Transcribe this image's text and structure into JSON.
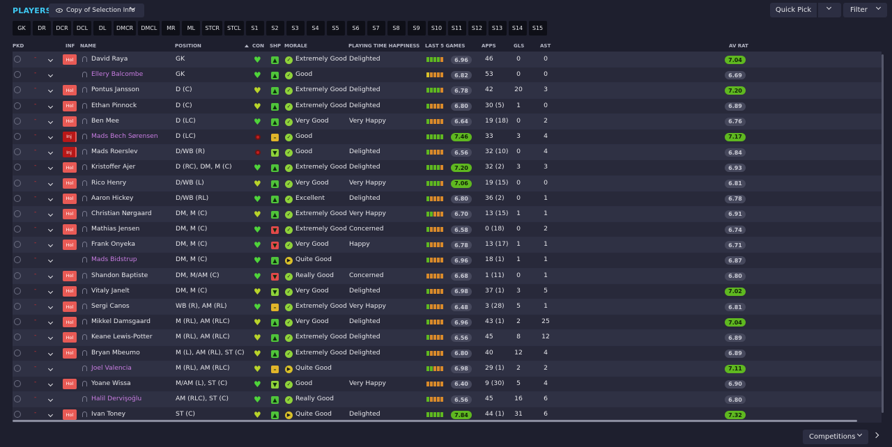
{
  "header": {
    "title": "PLAYERS",
    "selection_label": "Copy of Selection Info",
    "quick_pick": "Quick Pick",
    "filter": "Filter"
  },
  "positions": [
    "GK",
    "DR",
    "DCR",
    "DCL",
    "DL",
    "DMCR",
    "DMCL",
    "MR",
    "ML",
    "STCR",
    "STCL",
    "S1",
    "S2",
    "S3",
    "S4",
    "S5",
    "S6",
    "S7",
    "S8",
    "S9",
    "S10",
    "S11",
    "S12",
    "S13",
    "S14",
    "S15"
  ],
  "columns": {
    "pkd": "PKD",
    "inf": "INF",
    "name": "NAME",
    "position": "POSITION",
    "con": "CON",
    "shp": "SHP",
    "morale": "MORALE",
    "pth": "PLAYING TIME HAPPINESS",
    "last5": "LAST 5 GAMES",
    "apps": "APPS",
    "gls": "GLS",
    "ast": "AST",
    "avrat": "AV RAT"
  },
  "colors": {
    "accent": "#3ec7f0",
    "hol": "#e85a55",
    "inj": "#b81818",
    "loan_name": "#c77ce0",
    "green": "#5fb820",
    "orange": "#d98a2a",
    "yellow": "#d9c02a",
    "red": "#d84040"
  },
  "players": [
    {
      "name": "David Raya",
      "inf": "Hol",
      "loan": false,
      "position": "GK",
      "con": "heart-green",
      "shp": "up",
      "morale_icon": "tick",
      "morale": "Extremely Good",
      "pth": "Delighted",
      "form": [
        "g",
        "g",
        "g",
        "g",
        "o"
      ],
      "last5": "6.96",
      "last5_hi": false,
      "apps": "46",
      "gls": "0",
      "ast": "0",
      "avrat": "7.04",
      "avrat_hi": true
    },
    {
      "name": "Ellery Balcombe",
      "inf": "",
      "loan": true,
      "position": "GK",
      "con": "heart-green",
      "shp": "up",
      "morale_icon": "tick",
      "morale": "Good",
      "pth": "",
      "form": [
        "y",
        "o",
        "o",
        "o",
        "o"
      ],
      "last5": "6.82",
      "last5_hi": false,
      "apps": "53",
      "gls": "0",
      "ast": "0",
      "avrat": "6.69",
      "avrat_hi": false
    },
    {
      "name": "Pontus Jansson",
      "inf": "Hol",
      "loan": false,
      "position": "D (C)",
      "con": "heart-yellow",
      "shp": "up",
      "morale_icon": "tick",
      "morale": "Extremely Good",
      "pth": "Delighted",
      "form": [
        "g",
        "g",
        "g",
        "g",
        "o"
      ],
      "last5": "6.78",
      "last5_hi": false,
      "apps": "42",
      "gls": "20",
      "ast": "3",
      "avrat": "7.20",
      "avrat_hi": true
    },
    {
      "name": "Ethan Pinnock",
      "inf": "Hol",
      "loan": false,
      "position": "D (C)",
      "con": "heart-yellow",
      "shp": "up",
      "morale_icon": "tick",
      "morale": "Extremely Good",
      "pth": "Delighted",
      "form": [
        "g",
        "o",
        "o",
        "o",
        "o"
      ],
      "last5": "6.80",
      "last5_hi": false,
      "apps": "30 (5)",
      "gls": "1",
      "ast": "0",
      "avrat": "6.89",
      "avrat_hi": false
    },
    {
      "name": "Ben Mee",
      "inf": "Hol",
      "loan": false,
      "position": "D (LC)",
      "con": "heart-green",
      "shp": "up",
      "morale_icon": "tick",
      "morale": "Very Good",
      "pth": "Very Happy",
      "form": [
        "g",
        "o",
        "o",
        "o",
        "o"
      ],
      "last5": "6.64",
      "last5_hi": false,
      "apps": "19 (18)",
      "gls": "0",
      "ast": "2",
      "avrat": "6.76",
      "avrat_hi": false
    },
    {
      "name": "Mads Bech Sørensen",
      "inf": "Inj",
      "loan": true,
      "position": "D (LC)",
      "con": "red",
      "shp": "mid",
      "morale_icon": "tick",
      "morale": "Good",
      "pth": "",
      "form": [
        "g",
        "g",
        "g",
        "g",
        "g"
      ],
      "last5": "7.46",
      "last5_hi": true,
      "apps": "33",
      "gls": "3",
      "ast": "4",
      "avrat": "7.17",
      "avrat_hi": true
    },
    {
      "name": "Mads Roerslev",
      "inf": "Inj",
      "loan": false,
      "position": "D/WB (R)",
      "con": "red",
      "shp": "down",
      "morale_icon": "tick",
      "morale": "Good",
      "pth": "Delighted",
      "form": [
        "g",
        "o",
        "o",
        "o",
        "o"
      ],
      "last5": "6.56",
      "last5_hi": false,
      "apps": "32 (10)",
      "gls": "0",
      "ast": "4",
      "avrat": "6.84",
      "avrat_hi": false
    },
    {
      "name": "Kristoffer Ajer",
      "inf": "Hol",
      "loan": false,
      "position": "D (RC), DM, M (C)",
      "con": "heart-green",
      "shp": "up",
      "morale_icon": "tick",
      "morale": "Extremely Good",
      "pth": "Delighted",
      "form": [
        "g",
        "g",
        "g",
        "g",
        "o"
      ],
      "last5": "7.20",
      "last5_hi": true,
      "apps": "32 (2)",
      "gls": "3",
      "ast": "3",
      "avrat": "6.93",
      "avrat_hi": false
    },
    {
      "name": "Rico Henry",
      "inf": "Hol",
      "loan": false,
      "position": "D/WB (L)",
      "con": "heart-yellow",
      "shp": "up",
      "morale_icon": "tick",
      "morale": "Very Good",
      "pth": "Very Happy",
      "form": [
        "g",
        "g",
        "g",
        "g",
        "o"
      ],
      "last5": "7.06",
      "last5_hi": true,
      "apps": "19 (15)",
      "gls": "0",
      "ast": "0",
      "avrat": "6.81",
      "avrat_hi": false
    },
    {
      "name": "Aaron Hickey",
      "inf": "Hol",
      "loan": false,
      "position": "D/WB (RL)",
      "con": "heart-green",
      "shp": "up",
      "morale_icon": "tick",
      "morale": "Excellent",
      "pth": "Delighted",
      "form": [
        "g",
        "o",
        "o",
        "o",
        "o"
      ],
      "last5": "6.80",
      "last5_hi": false,
      "apps": "36 (2)",
      "gls": "0",
      "ast": "1",
      "avrat": "6.78",
      "avrat_hi": false
    },
    {
      "name": "Christian Nørgaard",
      "inf": "Hol",
      "loan": false,
      "position": "DM, M (C)",
      "con": "heart-yellow",
      "shp": "up",
      "morale_icon": "tick",
      "morale": "Extremely Good",
      "pth": "Very Happy",
      "form": [
        "g",
        "g",
        "o",
        "o",
        "o"
      ],
      "last5": "6.70",
      "last5_hi": false,
      "apps": "13 (15)",
      "gls": "1",
      "ast": "1",
      "avrat": "6.91",
      "avrat_hi": false
    },
    {
      "name": "Mathias Jensen",
      "inf": "Hol",
      "loan": false,
      "position": "DM, M (C)",
      "con": "heart-green",
      "shp": "down-red",
      "morale_icon": "tick",
      "morale": "Extremely Good",
      "pth": "Concerned",
      "form": [
        "g",
        "o",
        "o",
        "o",
        "o"
      ],
      "last5": "6.58",
      "last5_hi": false,
      "apps": "0 (18)",
      "gls": "0",
      "ast": "2",
      "avrat": "6.74",
      "avrat_hi": false
    },
    {
      "name": "Frank Onyeka",
      "inf": "Hol",
      "loan": false,
      "position": "DM, M (C)",
      "con": "heart-green",
      "shp": "down-red",
      "morale_icon": "tick",
      "morale": "Very Good",
      "pth": "Happy",
      "form": [
        "g",
        "o",
        "o",
        "o",
        "o"
      ],
      "last5": "6.78",
      "last5_hi": false,
      "apps": "13 (17)",
      "gls": "1",
      "ast": "1",
      "avrat": "6.71",
      "avrat_hi": false
    },
    {
      "name": "Mads Bidstrup",
      "inf": "",
      "loan": true,
      "position": "DM, M (C)",
      "con": "heart-green",
      "shp": "up",
      "morale_icon": "right",
      "morale": "Quite Good",
      "pth": "",
      "form": [
        "g",
        "o",
        "o",
        "o",
        "o"
      ],
      "last5": "6.96",
      "last5_hi": false,
      "apps": "18 (1)",
      "gls": "1",
      "ast": "1",
      "avrat": "6.87",
      "avrat_hi": false
    },
    {
      "name": "Shandon Baptiste",
      "inf": "Hol",
      "loan": false,
      "position": "DM, M/AM (C)",
      "con": "heart-green",
      "shp": "down-red",
      "morale_icon": "tick",
      "morale": "Really Good",
      "pth": "Concerned",
      "form": [
        "o",
        "o",
        "o",
        "o",
        "o"
      ],
      "last5": "6.68",
      "last5_hi": false,
      "apps": "1 (11)",
      "gls": "0",
      "ast": "1",
      "avrat": "6.80",
      "avrat_hi": false
    },
    {
      "name": "Vitaly Janelt",
      "inf": "Hol",
      "loan": false,
      "position": "DM, M (C)",
      "con": "heart-yellow",
      "shp": "down",
      "morale_icon": "tick",
      "morale": "Very Good",
      "pth": "Delighted",
      "form": [
        "g",
        "o",
        "o",
        "o",
        "o"
      ],
      "last5": "6.98",
      "last5_hi": false,
      "apps": "37 (1)",
      "gls": "3",
      "ast": "5",
      "avrat": "7.02",
      "avrat_hi": true
    },
    {
      "name": "Sergi Canos",
      "inf": "Hol",
      "loan": false,
      "position": "WB (R), AM (RL)",
      "con": "heart-green",
      "shp": "mid",
      "morale_icon": "tick",
      "morale": "Extremely Good",
      "pth": "Very Happy",
      "form": [
        "g",
        "o",
        "o",
        "o",
        "o"
      ],
      "last5": "6.48",
      "last5_hi": false,
      "apps": "3 (28)",
      "gls": "5",
      "ast": "1",
      "avrat": "6.81",
      "avrat_hi": false
    },
    {
      "name": "Mikkel Damsgaard",
      "inf": "Hol",
      "loan": false,
      "position": "M (RL), AM (RLC)",
      "con": "heart-yellow",
      "shp": "up",
      "morale_icon": "tick",
      "morale": "Very Good",
      "pth": "Delighted",
      "form": [
        "g",
        "o",
        "o",
        "o",
        "o"
      ],
      "last5": "6.96",
      "last5_hi": false,
      "apps": "43 (1)",
      "gls": "2",
      "ast": "25",
      "avrat": "7.04",
      "avrat_hi": true
    },
    {
      "name": "Keane Lewis-Potter",
      "inf": "Hol",
      "loan": false,
      "position": "M (RL), AM (RLC)",
      "con": "heart-yellow",
      "shp": "up",
      "morale_icon": "tick",
      "morale": "Extremely Good",
      "pth": "Delighted",
      "form": [
        "g",
        "o",
        "o",
        "o",
        "o"
      ],
      "last5": "6.56",
      "last5_hi": false,
      "apps": "45",
      "gls": "8",
      "ast": "12",
      "avrat": "6.89",
      "avrat_hi": false
    },
    {
      "name": "Bryan Mbeumo",
      "inf": "Hol",
      "loan": false,
      "position": "M (L), AM (RL), ST (C)",
      "con": "heart-yellow",
      "shp": "up",
      "morale_icon": "tick",
      "morale": "Extremely Good",
      "pth": "Delighted",
      "form": [
        "g",
        "o",
        "o",
        "o",
        "o"
      ],
      "last5": "6.80",
      "last5_hi": false,
      "apps": "40",
      "gls": "12",
      "ast": "4",
      "avrat": "6.89",
      "avrat_hi": false
    },
    {
      "name": "Joel Valencia",
      "inf": "",
      "loan": true,
      "position": "M (RL), AM (RLC)",
      "con": "heart-yellow",
      "shp": "mid",
      "morale_icon": "right",
      "morale": "Quite Good",
      "pth": "",
      "form": [
        "g",
        "g",
        "o",
        "o",
        "o"
      ],
      "last5": "6.98",
      "last5_hi": false,
      "apps": "29 (1)",
      "gls": "2",
      "ast": "2",
      "avrat": "7.11",
      "avrat_hi": true
    },
    {
      "name": "Yoane Wissa",
      "inf": "Hol",
      "loan": false,
      "position": "M/AM (L), ST (C)",
      "con": "heart-green",
      "shp": "down",
      "morale_icon": "tick",
      "morale": "Good",
      "pth": "Very Happy",
      "form": [
        "o",
        "o",
        "o",
        "o",
        "o"
      ],
      "last5": "6.40",
      "last5_hi": false,
      "apps": "9 (30)",
      "gls": "5",
      "ast": "4",
      "avrat": "6.90",
      "avrat_hi": false
    },
    {
      "name": "Halil Dervişoğlu",
      "inf": "",
      "loan": true,
      "position": "AM (RLC), ST (C)",
      "con": "heart-green",
      "shp": "up",
      "morale_icon": "tick",
      "morale": "Really Good",
      "pth": "",
      "form": [
        "g",
        "o",
        "o",
        "o",
        "o"
      ],
      "last5": "6.56",
      "last5_hi": false,
      "apps": "45",
      "gls": "16",
      "ast": "6",
      "avrat": "6.80",
      "avrat_hi": false
    },
    {
      "name": "Ivan Toney",
      "inf": "Hol",
      "loan": false,
      "position": "ST (C)",
      "con": "heart-yellow",
      "shp": "up",
      "morale_icon": "right",
      "morale": "Quite Good",
      "pth": "Delighted",
      "form": [
        "g",
        "g",
        "g",
        "g",
        "g"
      ],
      "last5": "7.84",
      "last5_hi": true,
      "apps": "44 (1)",
      "gls": "31",
      "ast": "6",
      "avrat": "7.32",
      "avrat_hi": true
    }
  ],
  "footer": {
    "competitions": "Competitions"
  }
}
